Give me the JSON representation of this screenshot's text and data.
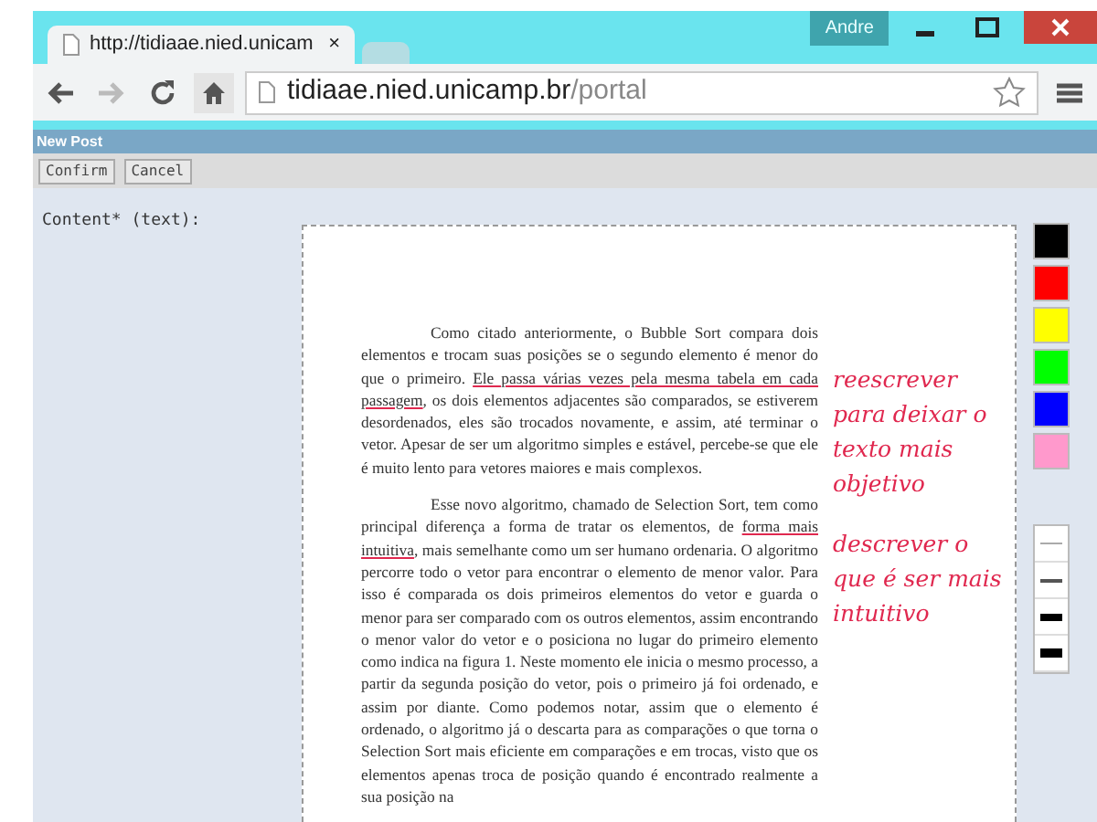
{
  "window": {
    "user": "Andre"
  },
  "tabs": [
    {
      "title": "http://tidiaae.nied.unicam",
      "selected": true,
      "close": "×"
    },
    {
      "selected": false
    }
  ],
  "address_bar": {
    "host": "tidiaae.nied.unicamp.br",
    "path": "/portal"
  },
  "form": {
    "title": "New Post",
    "buttons": [
      "Confirm",
      "Cancel"
    ],
    "field_label": "Content* (text):"
  },
  "document": {
    "paragraphs": [
      [
        {
          "text": "Como citado anteriormente, o Bubble Sort compara dois elementos e trocam suas posições se o segundo elemento é menor do que o primeiro. ",
          "underlined": false
        },
        {
          "text": "Ele passa várias vezes pela mesma tabela em cada passagem",
          "underlined": true
        },
        {
          "text": ", os dois elementos adjacentes são comparados, se estiverem desordenados, eles são trocados novamente, e assim, até terminar o vetor. Apesar de ser um algoritmo simples e estável, percebe-se que ele é muito lento para vetores maiores e mais complexos.",
          "underlined": false
        }
      ],
      [
        {
          "text": "Esse novo algoritmo, chamado de Selection Sort, tem como principal diferença a forma de tratar os elementos, de ",
          "underlined": false
        },
        {
          "text": "forma mais intuitiva",
          "underlined": true
        },
        {
          "text": ", mais semelhante como um ser humano ordenaria. O algoritmo percorre todo o vetor para encontrar o elemento de menor valor. Para isso é comparada os dois primeiros elementos do vetor e guarda o menor para ser comparado com os outros elementos, assim encontrando o menor valor do vetor e o posiciona no lugar do primeiro elemento como indica na figura 1. Neste momento ele inicia o mesmo processo, a partir da segunda posição do vetor, pois o primeiro já foi ordenado, e assim por diante. Como podemos notar, assim que o elemento é ordenado, o algoritmo já o descarta para as comparações o que torna o Selection Sort mais eficiente em comparações e em trocas, visto que os elementos apenas troca de posição quando é encontrado realmente a sua posição na",
          "underlined": false
        }
      ]
    ],
    "notes": [
      "reescrever para deixar o texto mais objetivo",
      "descrever o que é ser mais intuitivo"
    ]
  },
  "palette": [
    {
      "color": "#000000"
    },
    {
      "color": "#ff0000"
    },
    {
      "color": "#ffff00"
    },
    {
      "color": "#00ff00"
    },
    {
      "color": "#0000ff"
    },
    {
      "color": "#ff99cc"
    }
  ],
  "line_widths": [
    {
      "kind": "hairline"
    },
    {
      "kind": "thin"
    },
    {
      "kind": "thick"
    },
    {
      "kind": "heavy"
    }
  ]
}
